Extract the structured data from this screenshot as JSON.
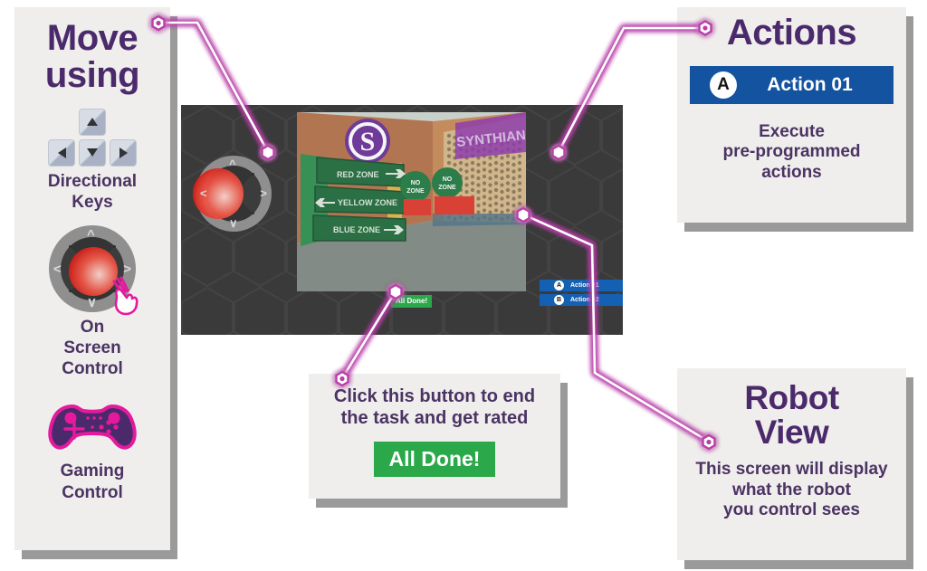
{
  "sidebar": {
    "title": "Move using",
    "title_line1": "Move",
    "title_line2": "using",
    "items": [
      {
        "icon": "directional-keys-icon",
        "label": "Directional\nKeys",
        "label_line1": "Directional",
        "label_line2": "Keys"
      },
      {
        "icon": "onscreen-joystick-icon",
        "label": "On Screen Control",
        "label_line1": "On",
        "label_line2": "Screen",
        "label_line3": "Control"
      },
      {
        "icon": "gamepad-icon",
        "label": "Gaming Control",
        "label_line1": "Gaming",
        "label_line2": "Control"
      }
    ]
  },
  "actions_card": {
    "title": "Actions",
    "button": {
      "badge": "A",
      "label": "Action 01"
    },
    "description_line1": "Execute",
    "description_line2": "pre-programmed",
    "description_line3": "actions"
  },
  "robot_card": {
    "title_line1": "Robot",
    "title_line2": "View",
    "description_line1": "This screen will display",
    "description_line2": "what the robot",
    "description_line3": "you control sees"
  },
  "done_card": {
    "description_line1": "Click this button to end",
    "description_line2": "the task and get rated",
    "button_label": "All Done!"
  },
  "simulation": {
    "action_buttons": [
      {
        "badge": "A",
        "label": "Action 01"
      },
      {
        "badge": "B",
        "label": "Action 02"
      }
    ],
    "all_done_label": "All Done!",
    "camera": {
      "logo_letter": "S",
      "wall_text": "SYNTHIAN",
      "signs": [
        {
          "text": "RED ZONE",
          "arrow": "right"
        },
        {
          "text": "YELLOW ZONE",
          "arrow": "left"
        },
        {
          "text": "BLUE ZONE",
          "arrow": "right"
        }
      ],
      "badges": [
        {
          "line1": "NO",
          "line2": "ZONE"
        },
        {
          "line1": "NO",
          "line2": "ZONE"
        }
      ]
    }
  },
  "colors": {
    "card_bg": "#efeeec",
    "card_shadow": "#9a9a9a",
    "title_purple": "#4b2a6b",
    "body_purple": "#4b3363",
    "connector_glow": "#b83fa8",
    "connector_core": "#ffffff",
    "action_blue": "#13539f",
    "sim_action_blue": "#1461b4",
    "done_green": "#2aa84a",
    "sim_bg": "#3a3a3a",
    "joystick_red": "#d8231b"
  }
}
